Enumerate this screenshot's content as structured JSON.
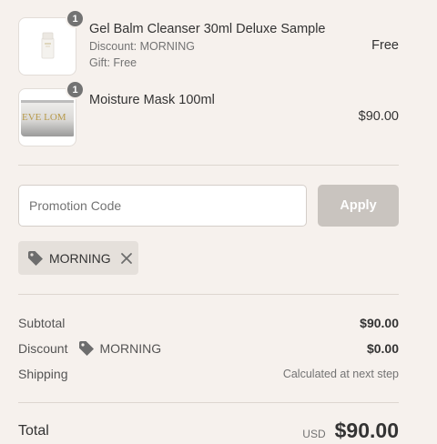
{
  "cart": {
    "items": [
      {
        "title": "Gel Balm Cleanser 30ml Deluxe Sample",
        "discount": "Discount: MORNING",
        "gift": "Gift: Free",
        "quantity": "1",
        "price": "Free"
      },
      {
        "title": "Moisture Mask 100ml",
        "quantity": "1",
        "price": "$90.00",
        "image_text": "EVE LOM"
      }
    ]
  },
  "promo": {
    "placeholder": "Promotion Code",
    "apply_label": "Apply",
    "applied_code": "MORNING"
  },
  "summary": {
    "subtotal_label": "Subtotal",
    "subtotal_value": "$90.00",
    "discount_label": "Discount",
    "discount_code": "MORNING",
    "discount_value": "$0.00",
    "shipping_label": "Shipping",
    "shipping_value": "Calculated at next step",
    "total_label": "Total",
    "currency": "USD",
    "total_value": "$90.00"
  },
  "icons": {
    "tag": "tag-icon",
    "remove": "close-icon"
  },
  "colors": {
    "background": "#f6f1ed",
    "apply_button": "#c9c4bf",
    "badge": "#737373",
    "tag_background": "#e5e0db"
  }
}
